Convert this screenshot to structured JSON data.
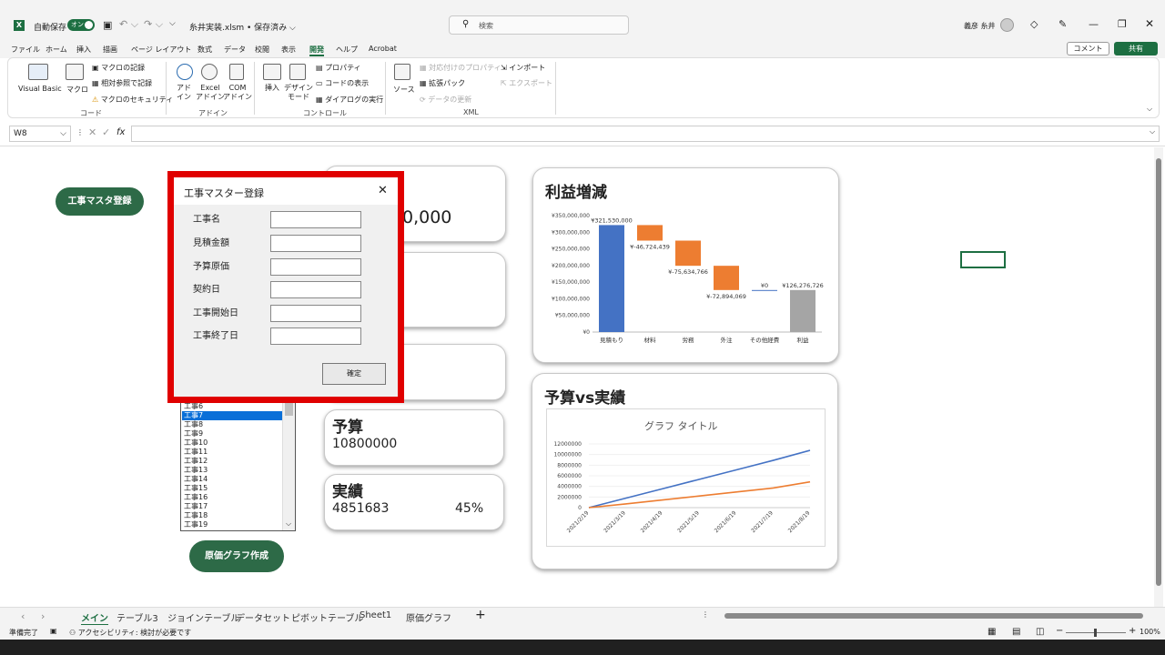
{
  "titlebar": {
    "autosave": "自動保存",
    "toggle": "オン",
    "filename": "糸井実装.xlsm • 保存済み ⌵",
    "search": "検索",
    "user": "義彦 糸井"
  },
  "menu": [
    "ファイル",
    "ホーム",
    "挿入",
    "描画",
    "ページ レイアウト",
    "数式",
    "データ",
    "校閲",
    "表示",
    "開発",
    "ヘルプ",
    "Acrobat"
  ],
  "menu_right": {
    "comment": "コメント",
    "share": "共有"
  },
  "ribbon": {
    "vb": "Visual Basic",
    "macro": "マクロ",
    "rec": "マクロの記録",
    "rel": "相対参照で記録",
    "sec": "マクロのセキュリティ",
    "g_code": "コード",
    "addin": "アド\nイン",
    "excel_addin": "Excel\nアドイン",
    "com_addin": "COM\nアドイン",
    "g_addin": "アドイン",
    "insert": "挿入",
    "design": "デザイン\nモード",
    "prop": "プロパティ",
    "code": "コードの表示",
    "dlg": "ダイアログの実行",
    "g_ctrl": "コントロール",
    "source": "ソース",
    "map": "対応付けのプロパティ",
    "ext": "拡張パック",
    "refresh": "データの更新",
    "imp": "インポート",
    "exp": "エクスポート",
    "g_xml": "XML"
  },
  "formula": {
    "cell": "W8",
    "fx": "fx"
  },
  "buttons": {
    "register": "工事マスタ登録",
    "cost_graph": "原価グラフ作成"
  },
  "card1": {
    "value": "0,000"
  },
  "budget": {
    "title": "予算",
    "value": "10800000"
  },
  "actual": {
    "title": "実績",
    "value": "4851683",
    "pct": "45%"
  },
  "listbox": [
    "工事6",
    "工事7",
    "工事8",
    "工事9",
    "工事10",
    "工事11",
    "工事12",
    "工事13",
    "工事14",
    "工事15",
    "工事16",
    "工事17",
    "工事18",
    "工事19"
  ],
  "dialog": {
    "title": "工事マスター登録",
    "close": "✕",
    "fields": [
      "工事名",
      "見積金額",
      "予算原価",
      "契約日",
      "工事開始日",
      "工事終了日"
    ],
    "ok": "確定"
  },
  "waterfall": {
    "title": "利益増減"
  },
  "linechart": {
    "title": "予算vs実績",
    "inner_title": "グラフ タイトル"
  },
  "chart_data": [
    {
      "type": "bar",
      "title": "利益増減",
      "categories": [
        "見積もり",
        "材料",
        "労務",
        "外注",
        "その他経費",
        "利益"
      ],
      "values": [
        321530000,
        -46724439,
        -75634766,
        -72894069,
        0,
        126276726
      ],
      "labels": [
        "¥321,530,000",
        "¥-46,724,439",
        "¥-75,634,766",
        "¥-72,894,069",
        "¥0",
        "¥126,276,726"
      ],
      "yticks": [
        "¥350,000,000",
        "¥300,000,000",
        "¥250,000,000",
        "¥200,000,000",
        "¥150,000,000",
        "¥100,000,000",
        "¥50,000,000",
        "¥0"
      ],
      "ylim": [
        0,
        350000000
      ],
      "colors": [
        "#4472c4",
        "#ed7d31",
        "#ed7d31",
        "#ed7d31",
        "#4472c4",
        "#a5a5a5"
      ]
    },
    {
      "type": "line",
      "title": "グラフ タイトル",
      "x": [
        "2021/2/19",
        "2021/3/19",
        "2021/4/19",
        "2021/5/19",
        "2021/6/19",
        "2021/7/19",
        "2021/8/19"
      ],
      "yticks": [
        "12000000",
        "10000000",
        "8000000",
        "6000000",
        "4000000",
        "2000000",
        "0"
      ],
      "ylim": [
        0,
        12000000
      ],
      "series": [
        {
          "values": [
            0,
            1780000,
            3560000,
            5340000,
            7120000,
            8900000,
            10800000
          ],
          "color": "#4472c4"
        },
        {
          "values": [
            0,
            700000,
            1450000,
            2200000,
            2950000,
            3700000,
            4851683
          ],
          "color": "#ed7d31"
        }
      ]
    }
  ],
  "sheets": [
    "メイン",
    "テーブル3",
    "ジョインテーブル",
    "データセット",
    "ピボットテーブル",
    "Sheet1",
    "原価グラフ"
  ],
  "status": {
    "ready": "準備完了",
    "access": "アクセシビリティ: 検討が必要です",
    "zoom": "100%"
  }
}
